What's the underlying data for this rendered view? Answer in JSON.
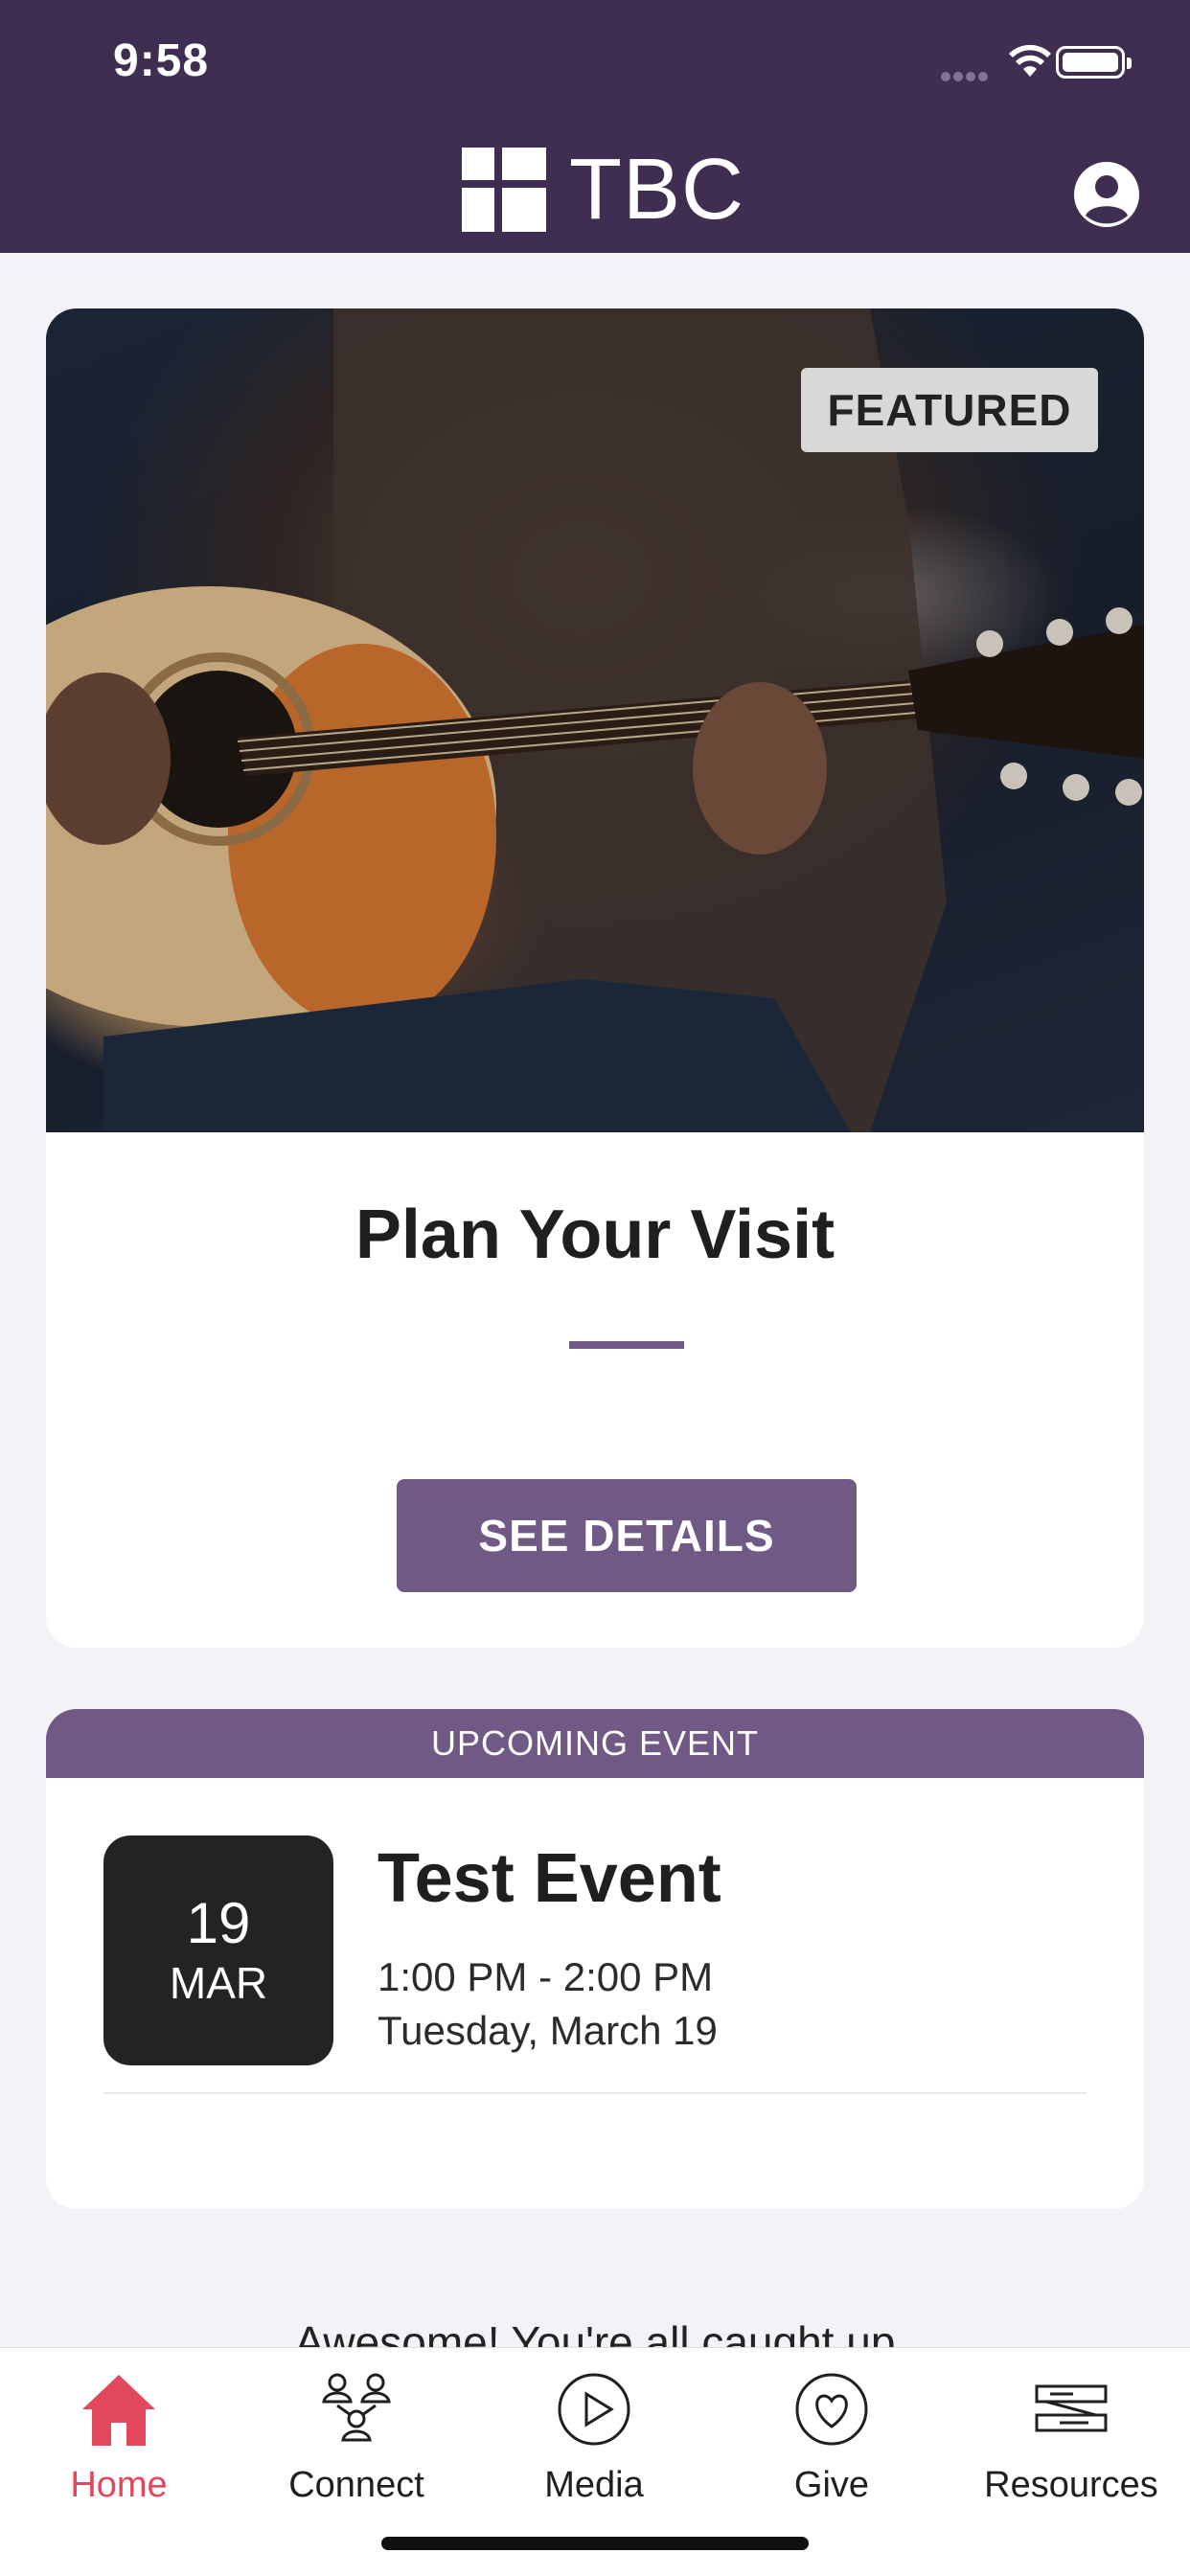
{
  "status_bar": {
    "time": "9:58"
  },
  "header": {
    "logo_text": "TBC"
  },
  "featured": {
    "badge": "FEATURED",
    "title": "Plan Your Visit",
    "button_label": "SEE DETAILS"
  },
  "event": {
    "section_label": "UPCOMING EVENT",
    "day": "19",
    "month": "MAR",
    "title": "Test Event",
    "time": "1:00 PM - 2:00 PM",
    "date": "Tuesday, March 19"
  },
  "footer_message": "Awesome! You're all caught up",
  "tabs": [
    {
      "label": "Home",
      "icon": "home-icon"
    },
    {
      "label": "Connect",
      "icon": "people-icon"
    },
    {
      "label": "Media",
      "icon": "play-circle-icon"
    },
    {
      "label": "Give",
      "icon": "heart-circle-icon"
    },
    {
      "label": "Resources",
      "icon": "bible-icon"
    }
  ],
  "colors": {
    "header_bg": "#3f2e51",
    "accent": "#705a85",
    "active_tab": "#e2475c",
    "page_bg": "#f2f2f7"
  }
}
